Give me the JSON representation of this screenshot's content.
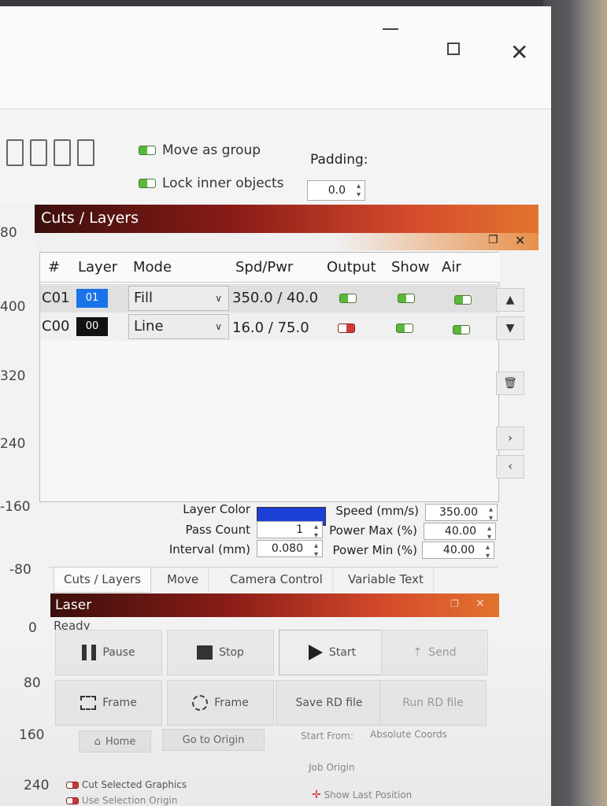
{
  "toolbar": {
    "move_as_group": "Move as group",
    "lock_inner_objects": "Lock inner objects",
    "padding_label": "Padding:",
    "padding_value": "0.0"
  },
  "ruler": [
    "80",
    "400",
    "320",
    "240",
    "-160",
    "-80",
    "0",
    "80",
    "160",
    "240"
  ],
  "cuts_panel": {
    "title": "Cuts / Layers",
    "columns": [
      "#",
      "Layer",
      "Mode",
      "Spd/Pwr",
      "Output",
      "Show",
      "Air"
    ],
    "rows": [
      {
        "id": "C01",
        "layer": "01",
        "color": "#1a73e8",
        "mode": "Fill",
        "spd_pwr": "350.0 / 40.0",
        "output": true,
        "show": true,
        "air": true
      },
      {
        "id": "C00",
        "layer": "00",
        "color": "#111111",
        "mode": "Line",
        "spd_pwr": "16.0 / 75.0",
        "output": false,
        "show": true,
        "air": true
      }
    ],
    "props": {
      "layer_color_label": "Layer Color",
      "layer_color": "#1c3fd6",
      "pass_count_label": "Pass Count",
      "pass_count": "1",
      "interval_label": "Interval (mm)",
      "interval": "0.080",
      "speed_label": "Speed (mm/s)",
      "speed": "350.00",
      "power_max_label": "Power Max (%)",
      "power_max": "40.00",
      "power_min_label": "Power Min (%)",
      "power_min": "40.00"
    }
  },
  "tabs": [
    "Cuts / Layers",
    "Move",
    "Camera Control",
    "Variable Text"
  ],
  "laser_panel": {
    "title": "Laser",
    "status": "Ready",
    "buttons": {
      "pause": "Pause",
      "stop": "Stop",
      "start": "Start",
      "send": "Send",
      "frame1": "Frame",
      "frame2": "Frame",
      "save_rd": "Save RD file",
      "run_rd": "Run RD file",
      "home": "Home",
      "go_to_origin": "Go to Origin"
    },
    "start_from_label": "Start From:",
    "start_from_value": "Absolute Coords",
    "job_origin_label": "Job Origin",
    "cut_selected": "Cut Selected Graphics",
    "use_selection_origin": "Use Selection Origin",
    "show_last_position": "Show Last Position"
  }
}
